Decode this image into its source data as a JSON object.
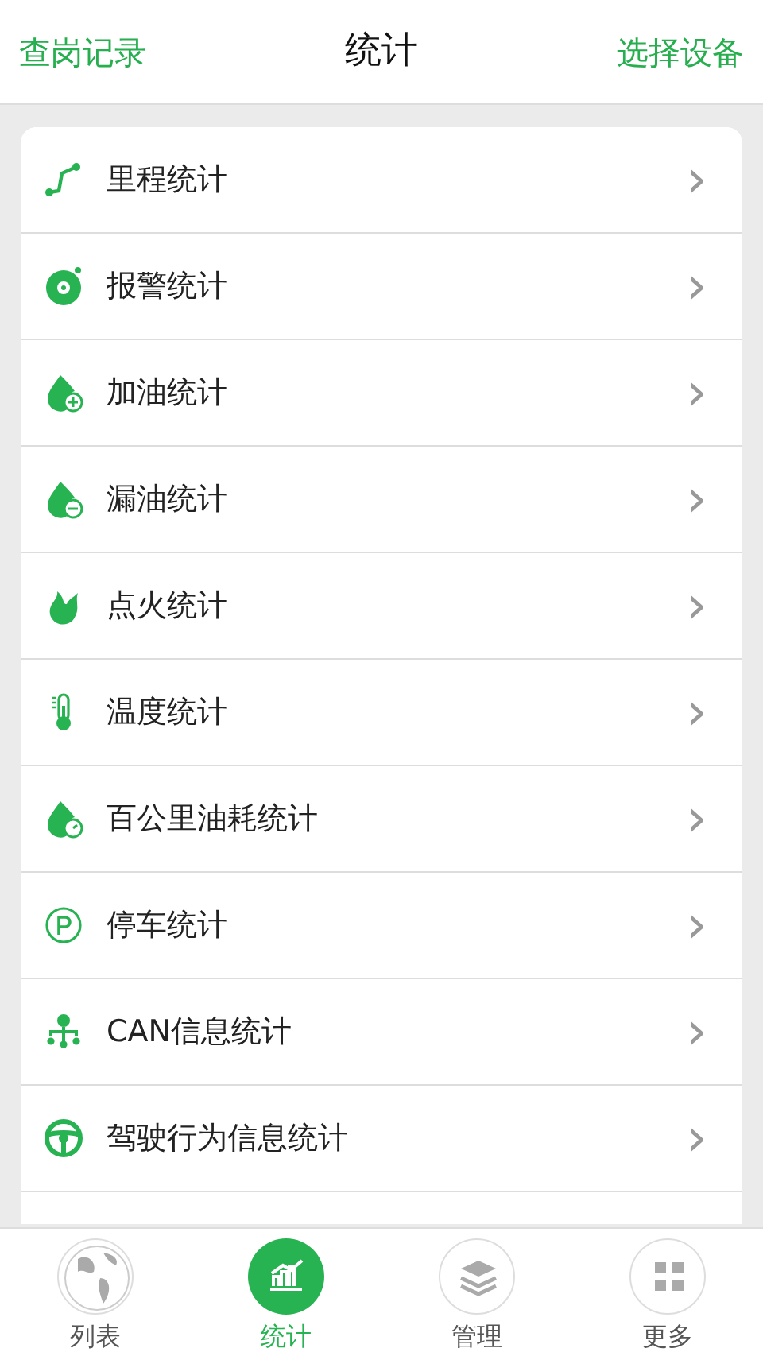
{
  "header": {
    "left_button": "查岗记录",
    "title": "统计",
    "right_button": "选择设备"
  },
  "items": [
    {
      "label": "里程统计",
      "chevron": "›"
    },
    {
      "label": "报警统计",
      "chevron": "›"
    },
    {
      "label": "加油统计",
      "chevron": "›"
    },
    {
      "label": "漏油统计",
      "chevron": "›"
    },
    {
      "label": "点火统计",
      "chevron": "›"
    },
    {
      "label": "温度统计",
      "chevron": "›"
    },
    {
      "label": "百公里油耗统计",
      "chevron": "›"
    },
    {
      "label": "停车统计",
      "chevron": "›"
    },
    {
      "label": "CAN信息统计",
      "chevron": "›"
    },
    {
      "label": "驾驶行为信息统计",
      "chevron": "›"
    }
  ],
  "tab_bar": [
    {
      "label": "列表",
      "selected": false
    },
    {
      "label": "统计",
      "selected": true
    },
    {
      "label": "管理",
      "selected": false
    },
    {
      "label": "更多",
      "selected": false
    }
  ]
}
